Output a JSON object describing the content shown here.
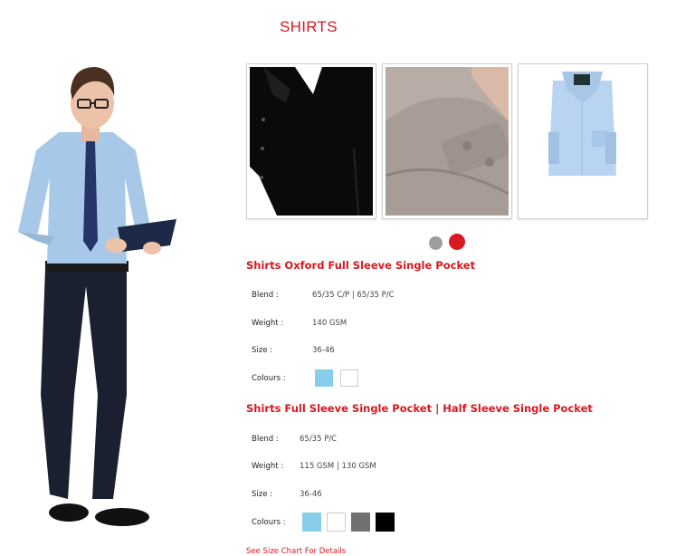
{
  "page": {
    "title": "SHIRTS"
  },
  "carousel": {
    "active_index": 2
  },
  "products": [
    {
      "name": "Shirts Oxford Full Sleeve Single Pocket",
      "specs": [
        {
          "label": "Blend :",
          "value": "65/35 C/P | 65/35 P/C"
        },
        {
          "label": "Weight :",
          "value": "140 GSM"
        },
        {
          "label": "Size :",
          "value": "36-46"
        },
        {
          "label": "Colours :",
          "value": ""
        }
      ],
      "colours": [
        "#87ceeb",
        "#ffffff"
      ]
    },
    {
      "name": "Shirts Full Sleeve Single Pocket | Half Sleeve Single Pocket",
      "specs": [
        {
          "label": "Blend :",
          "value": "65/35 P/C"
        },
        {
          "label": "Weight :",
          "value": "115 GSM | 130 GSM"
        },
        {
          "label": "Size :",
          "value": "36-46"
        },
        {
          "label": "Colours :",
          "value": ""
        }
      ],
      "colours": [
        "#87ceeb",
        "#ffffff",
        "#707070",
        "#000000"
      ]
    }
  ],
  "size_chart_link": "See Size Chart For Details"
}
